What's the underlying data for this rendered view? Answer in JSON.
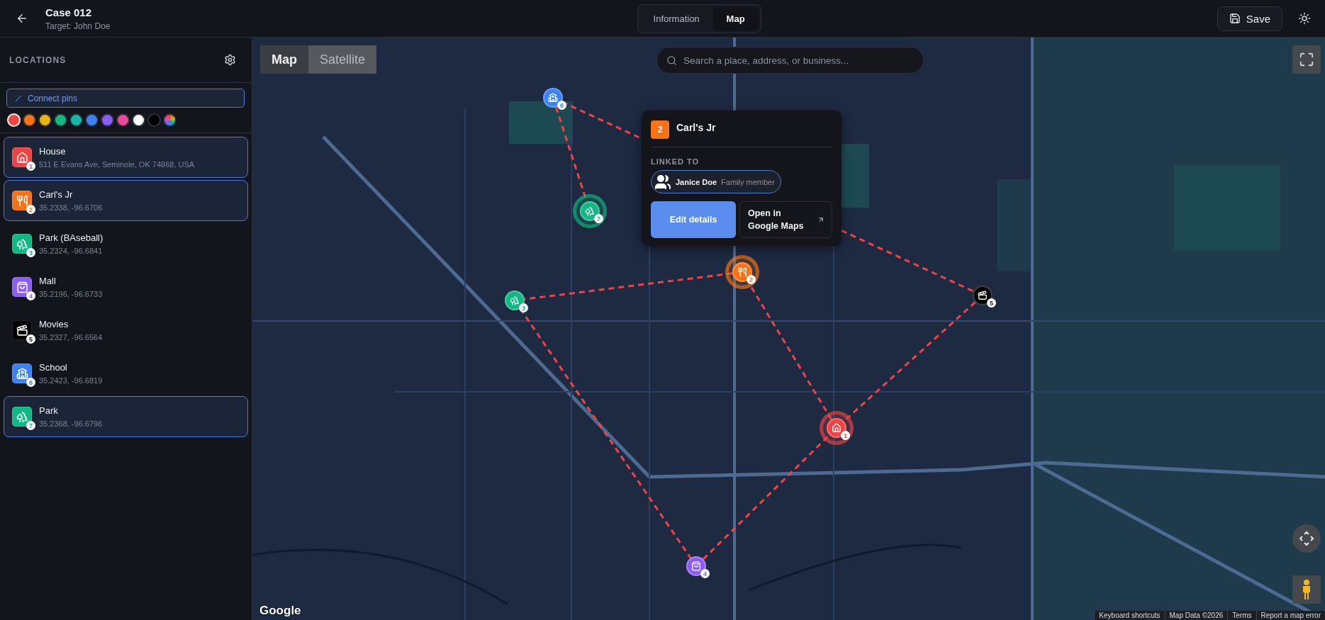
{
  "header": {
    "title": "Case 012",
    "subtitle": "Target: John Doe"
  },
  "tabs": [
    {
      "label": "Information",
      "selected": false
    },
    {
      "label": "Map",
      "selected": true
    }
  ],
  "save_button": "Save",
  "sidebar": {
    "title": "LOCATIONS",
    "connect_button": "Connect pins",
    "palette": [
      {
        "kind": "solid",
        "color": "#ef4444",
        "selected": true
      },
      {
        "kind": "solid",
        "color": "#f97316",
        "selected": false
      },
      {
        "kind": "solid",
        "color": "#eab308",
        "selected": false
      },
      {
        "kind": "solid",
        "color": "#10b981",
        "selected": false
      },
      {
        "kind": "solid",
        "color": "#14b8a6",
        "selected": false
      },
      {
        "kind": "solid",
        "color": "#3b82f6",
        "selected": false
      },
      {
        "kind": "solid",
        "color": "#8b5cf6",
        "selected": false
      },
      {
        "kind": "solid",
        "color": "#ec4899",
        "selected": false
      },
      {
        "kind": "solid",
        "color": "#ffffff",
        "selected": false
      },
      {
        "kind": "solid",
        "color": "#000000",
        "selected": false
      },
      {
        "kind": "gradient",
        "selected": false
      }
    ],
    "items": [
      {
        "name": "House",
        "detail": "511 E Evans Ave, Seminole, OK 74868, USA",
        "number": "1",
        "kind": "house",
        "color": "#ef4444",
        "selected": true
      },
      {
        "name": "Carl's Jr",
        "detail": "35.2338, -96.6706",
        "number": "2",
        "kind": "food",
        "color": "#f97316",
        "selected": true
      },
      {
        "name": "Park (BAseball)",
        "detail": "35.2324, -96.6841",
        "number": "3",
        "kind": "park",
        "color": "#10b981",
        "selected": false
      },
      {
        "name": "Mall",
        "detail": "35.2196, -96.6733",
        "number": "4",
        "kind": "shopping",
        "color": "#8b5cf6",
        "selected": false
      },
      {
        "name": "Movies",
        "detail": "35.2327, -96.6564",
        "number": "5",
        "kind": "cinema",
        "color": "#000000",
        "selected": false
      },
      {
        "name": "School",
        "detail": "35.2423, -96.6819",
        "number": "6",
        "kind": "school",
        "color": "#3b82f6",
        "selected": false
      },
      {
        "name": "Park",
        "detail": "35.2368, -96.6796",
        "number": "7",
        "kind": "park",
        "color": "#10b981",
        "selected": true
      }
    ]
  },
  "map": {
    "type_toggle": [
      {
        "label": "Map",
        "selected": true
      },
      {
        "label": "Satellite",
        "selected": false
      }
    ],
    "search": {
      "placeholder": "Search a place, address, or business..."
    },
    "pins": [
      {
        "number": "1",
        "kind": "house",
        "color": "#ef4444",
        "selected": true
      },
      {
        "number": "2",
        "kind": "food",
        "color": "#f97316",
        "selected": true
      },
      {
        "number": "3",
        "kind": "park",
        "color": "#10b981",
        "selected": false
      },
      {
        "number": "4",
        "kind": "shopping",
        "color": "#8b5cf6",
        "selected": false
      },
      {
        "number": "5",
        "kind": "cinema",
        "color": "#000000",
        "selected": false
      },
      {
        "number": "6",
        "kind": "school",
        "color": "#3b82f6",
        "selected": false
      },
      {
        "number": "7",
        "kind": "park",
        "color": "#10b981",
        "selected": true
      }
    ],
    "popup": {
      "number": "2",
      "color": "#f97316",
      "title": "Carl's Jr",
      "linked_label": "LINKED TO",
      "linked": [
        {
          "name": "Janice Doe",
          "role": "Family member"
        }
      ],
      "edit_button": "Edit details",
      "open_button": "Open in Google Maps"
    },
    "logo": "Google",
    "attribution": [
      "Keyboard shortcuts",
      "Map Data ©2026",
      "Terms",
      "Report a map error"
    ]
  }
}
